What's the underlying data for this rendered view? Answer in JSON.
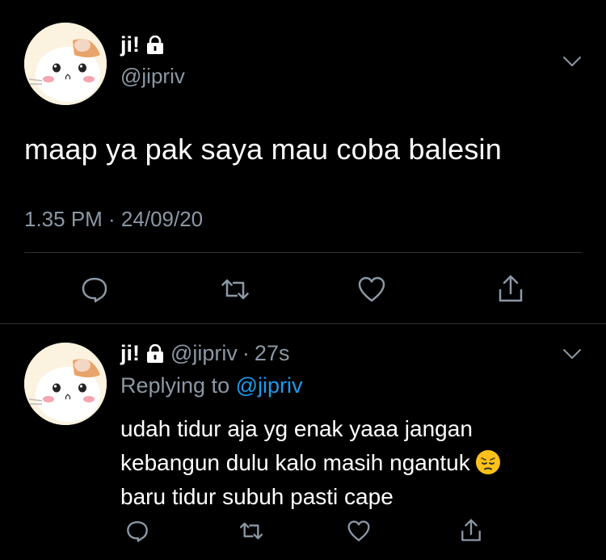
{
  "main_tweet": {
    "display_name": "ji!",
    "handle": "@jipriv",
    "text": "maap ya pak saya mau coba balesin",
    "timestamp": "1.35 PM · 24/09/20",
    "avatar_icon": "hamster-avatar-icon",
    "locked_icon": "lock-icon"
  },
  "reply_tweet": {
    "display_name": "ji!",
    "handle": "@jipriv",
    "separator": "·",
    "time": "27s",
    "replying_prefix": "Replying to",
    "replying_to": "@jipriv",
    "lines": [
      "udah tidur aja yg enak yaaa jangan",
      "kebangun dulu kalo masih ngantuk",
      "baru tidur subuh pasti cape"
    ],
    "emoji_icon": "pensive-face-emoji-icon"
  },
  "colors": {
    "background": "#000000",
    "text": "#ffffff",
    "secondary": "#8b98a5",
    "link": "#1d9bf0",
    "divider": "#2f3336"
  }
}
